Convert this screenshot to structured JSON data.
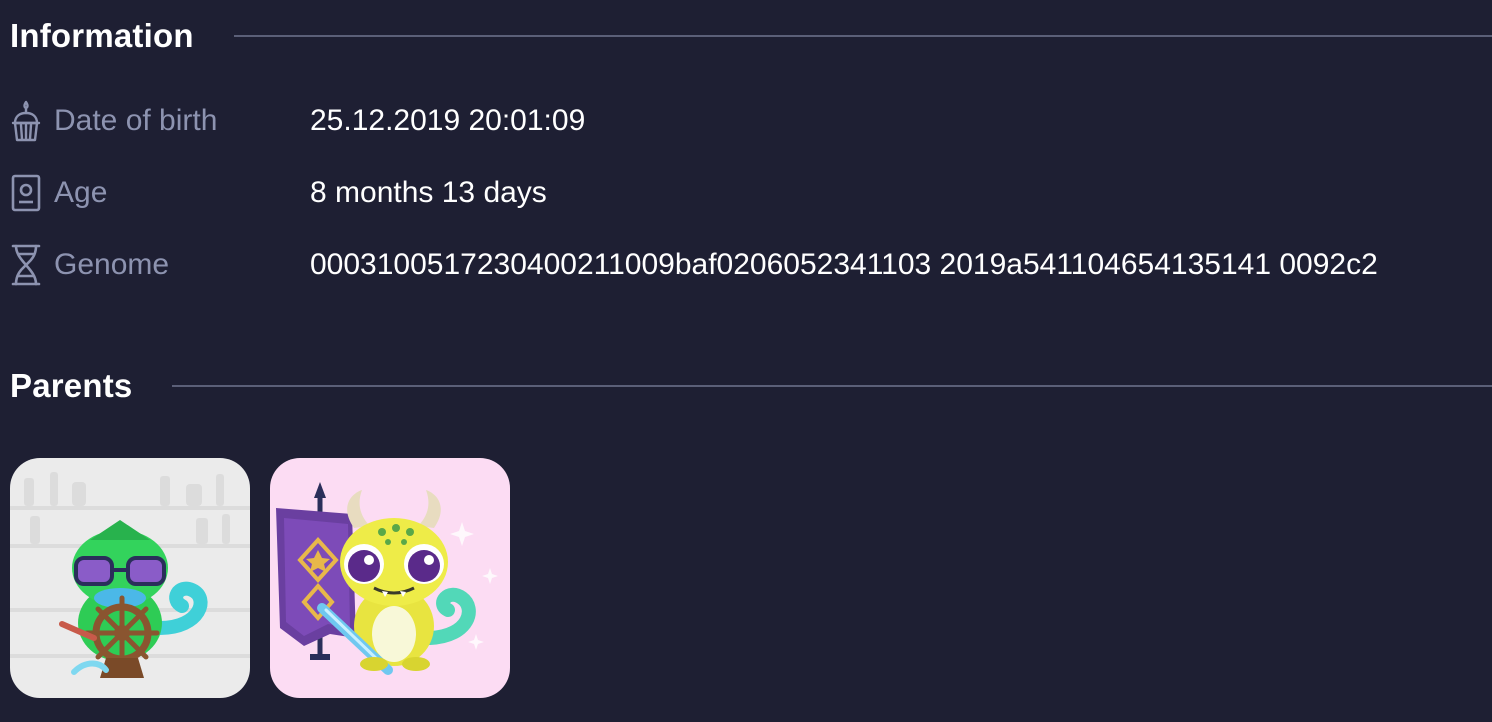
{
  "information": {
    "title": "Information",
    "rows": [
      {
        "icon": "cupcake-icon",
        "label": "Date of birth",
        "value": "25.12.2019 20:01:09"
      },
      {
        "icon": "id-card-icon",
        "label": "Age",
        "value": "8 months 13 days"
      },
      {
        "icon": "dna-icon",
        "label": "Genome",
        "value": "0003100517230400211009baf0206052341103 2019a541104654135141 0092c2"
      }
    ]
  },
  "parents": {
    "title": "Parents",
    "items": [
      {
        "name": "parent-1",
        "image": "green-lizard-with-glasses-and-ship-wheel"
      },
      {
        "name": "parent-2",
        "image": "yellow-horned-lizard-with-purple-banner"
      }
    ]
  },
  "colors": {
    "background": "#1e1f33",
    "label": "#8d93b0",
    "divider": "#5b5f78",
    "text": "#ffffff"
  }
}
